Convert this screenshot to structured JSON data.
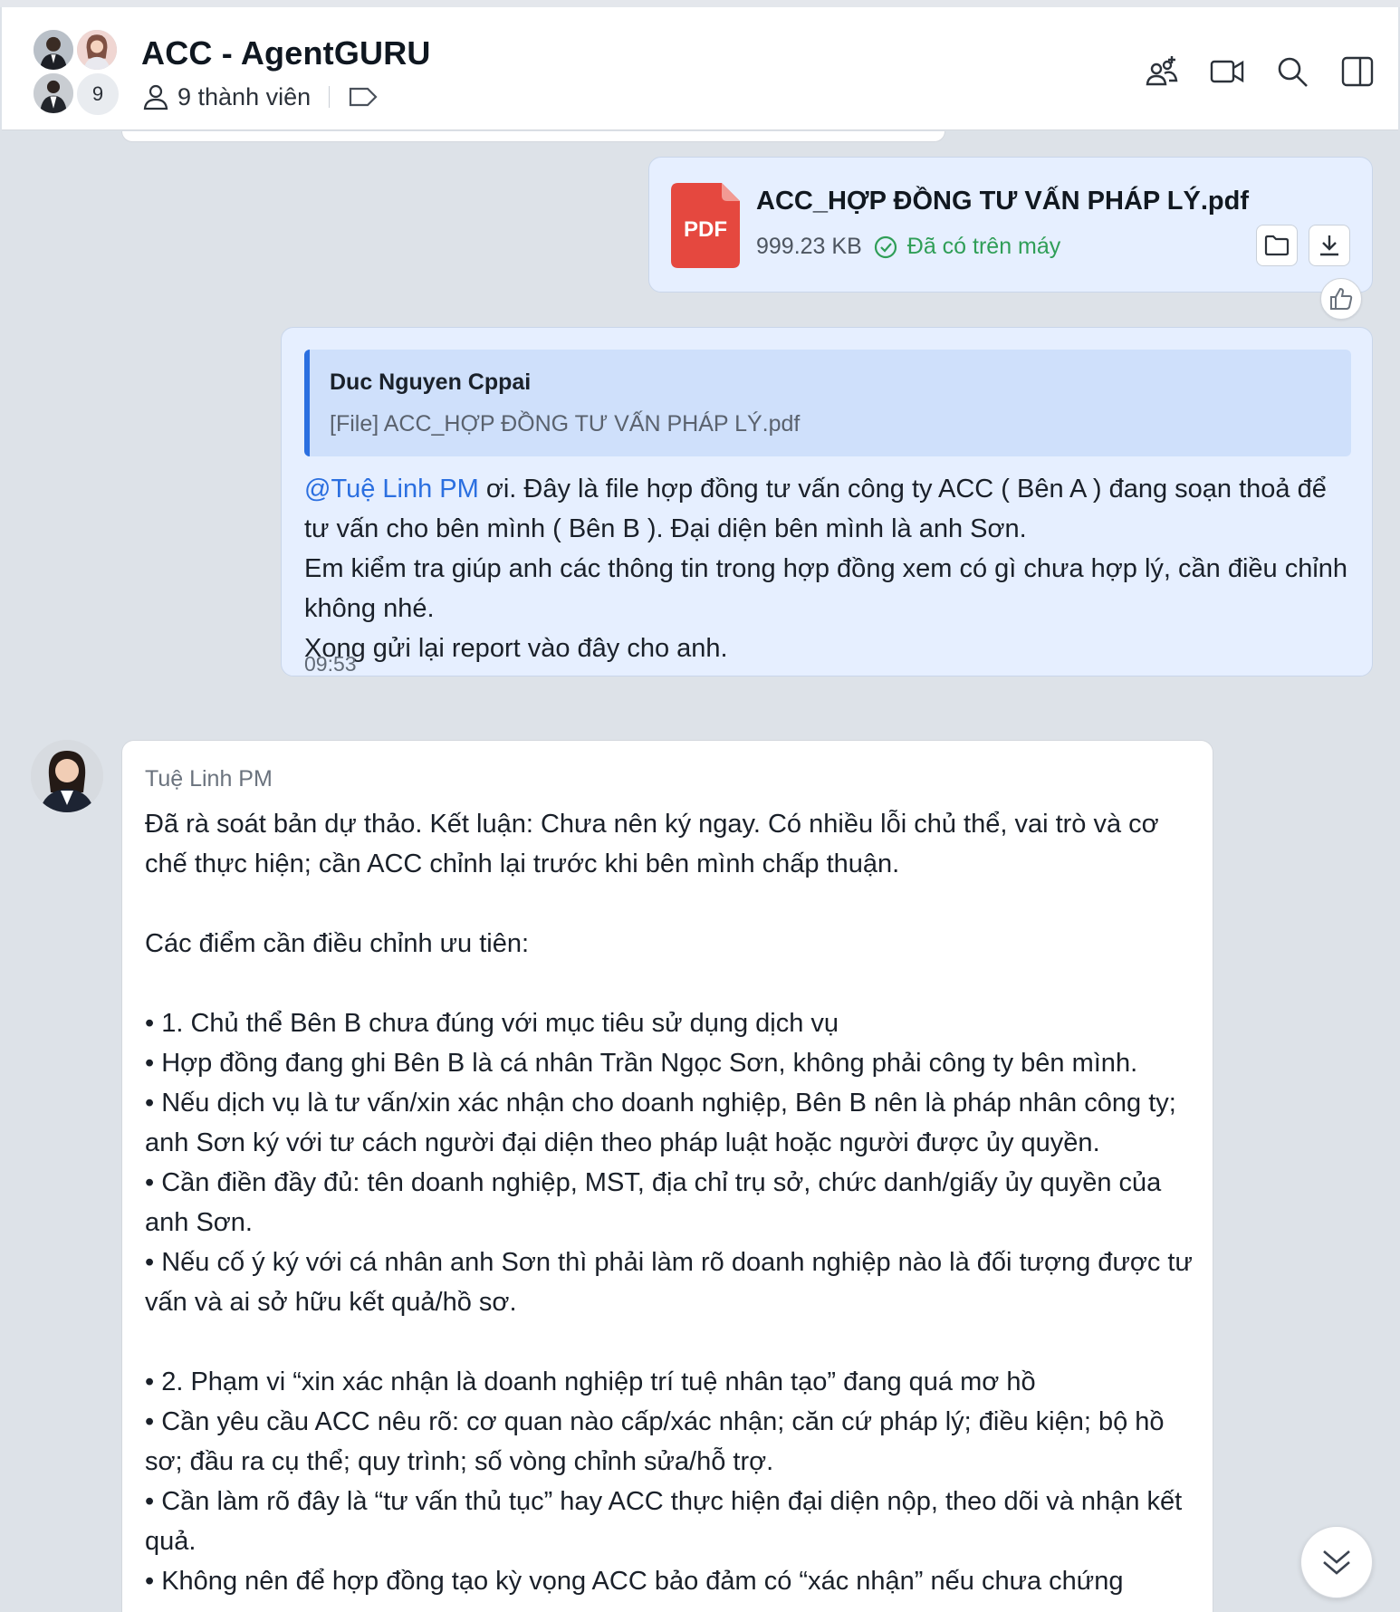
{
  "header": {
    "title": "ACC - AgentGURU",
    "member_count_badge": "9",
    "member_count_text": "9 thành viên",
    "icons": [
      "add-member-icon",
      "video-call-icon",
      "search-icon",
      "sidebar-toggle-icon"
    ]
  },
  "file_message": {
    "file_name": "ACC_HỢP ĐỒNG TƯ VẤN PHÁP LÝ.pdf",
    "file_type_label": "PDF",
    "file_size": "999.23 KB",
    "status": "Đã có trên máy",
    "status_color": "#2f9e57"
  },
  "message": {
    "quote_author": "Duc Nguyen Cppai",
    "quote_text": "[File] ACC_HỢP ĐỒNG TƯ VẤN PHÁP LÝ.pdf",
    "mention": "@Tuệ Linh PM",
    "line1_rest": " ơi. Đây là file hợp đồng tư vấn công ty ACC ( Bên A ) đang soạn thoả để tư vấn cho bên mình ( Bên B ). Đại diện bên mình là anh Sơn.",
    "line2": "Em kiểm tra giúp anh các thông tin trong hợp đồng xem có gì chưa hợp lý, cần điều chỉnh không nhé.",
    "line3": "Xong gửi lại report vào đây cho anh.",
    "time": "09:53"
  },
  "reply": {
    "sender": "Tuệ Linh PM",
    "lines": [
      "Đã rà soát bản dự thảo. Kết luận: Chưa nên ký ngay. Có nhiều lỗi chủ thể, vai trò và cơ chế thực hiện; cần ACC chỉnh lại trước khi bên mình chấp thuận.",
      "",
      "Các điểm cần điều chỉnh ưu tiên:",
      "",
      "• 1. Chủ thể Bên B chưa đúng với mục tiêu sử dụng dịch vụ",
      "• Hợp đồng đang ghi Bên B là cá nhân Trần Ngọc Sơn, không phải công ty bên mình.",
      "• Nếu dịch vụ là tư vấn/xin xác nhận cho doanh nghiệp, Bên B nên là pháp nhân công ty; anh Sơn ký với tư cách người đại diện theo pháp luật hoặc người được ủy quyền.",
      "• Cần điền đầy đủ: tên doanh nghiệp, MST, địa chỉ trụ sở, chức danh/giấy ủy quyền của anh Sơn.",
      "• Nếu cố ý ký với cá nhân anh Sơn thì phải làm rõ doanh nghiệp nào là đối tượng được tư vấn và ai sở hữu kết quả/hồ sơ.",
      "",
      "• 2. Phạm vi “xin xác nhận là doanh nghiệp trí tuệ nhân tạo” đang quá mơ hồ",
      "• Cần yêu cầu ACC nêu rõ: cơ quan nào cấp/xác nhận; căn cứ pháp lý; điều kiện; bộ hồ sơ; đầu ra cụ thể; quy trình; số vòng chỉnh sửa/hỗ trợ.",
      "• Cần làm rõ đây là “tư vấn thủ tục” hay ACC thực hiện đại diện nộp, theo dõi và nhận kết quả.",
      "• Không nên để hợp đồng tạo kỳ vọng ACC bảo đảm có “xác nhận” nếu chưa chứng"
    ]
  },
  "colors": {
    "accent": "#2b6fe0",
    "bubble_self": "#e6efff",
    "quote_bg": "#cfe0fb",
    "pdf_red": "#e5483f",
    "chat_bg": "#dde2e8"
  }
}
